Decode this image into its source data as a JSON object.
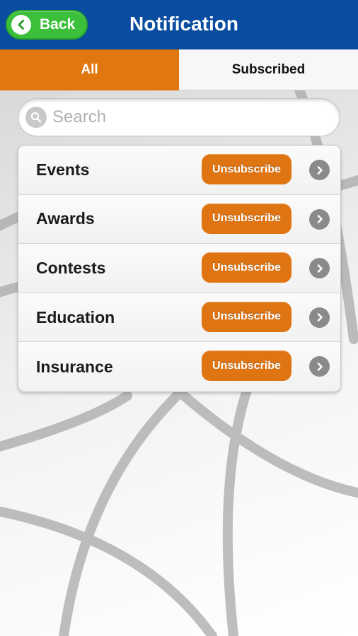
{
  "header": {
    "back_label": "Back",
    "title": "Notification"
  },
  "tabs": [
    {
      "label": "All",
      "selected": true
    },
    {
      "label": "Subscribed",
      "selected": false
    }
  ],
  "search": {
    "placeholder": "Search",
    "value": ""
  },
  "notifications": {
    "items": [
      {
        "label": "Events",
        "action_label": "Unsubscribe"
      },
      {
        "label": "Awards",
        "action_label": "Unsubscribe"
      },
      {
        "label": "Contests",
        "action_label": "Unsubscribe"
      },
      {
        "label": "Education",
        "action_label": "Unsubscribe"
      },
      {
        "label": "Insurance",
        "action_label": "Unsubscribe"
      }
    ]
  },
  "colors": {
    "nav_bar": "#0a4da0",
    "back_button": "#3cbf3a",
    "active_tab": "#e0780f",
    "unsubscribe_button": "#df7512"
  },
  "icons": {
    "back": "chevron-left-icon",
    "search": "search-icon",
    "row_disclosure": "chevron-right-icon"
  }
}
